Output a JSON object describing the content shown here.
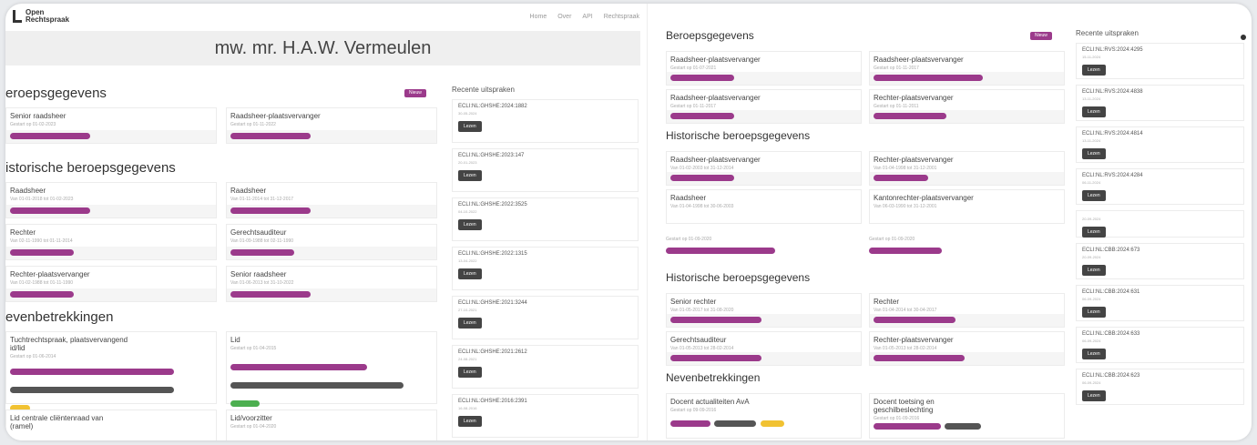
{
  "left": {
    "logo_line1": "Open",
    "logo_line2": "Rechtspraak",
    "nav": [
      "Home",
      "Over",
      "API",
      "Rechtspraak"
    ],
    "name": "mw. mr. H.A.W. Vermeulen",
    "badge_new": "Nieuw",
    "sec1": "eroepsgegevens",
    "beroep": [
      {
        "title": "Senior raadsheer",
        "sub": "Gestart op 01-02-2023"
      },
      {
        "title": "Raadsheer-plaatsvervanger",
        "sub": "Gestart op 01-11-2022"
      }
    ],
    "sec2": "istorische beroepsgegevens",
    "historisch": [
      {
        "title": "Raadsheer",
        "sub": "Van 01-01-2018 tot 01-02-2023"
      },
      {
        "title": "Raadsheer",
        "sub": "Van 01-11-2014 tot 31-12-2017"
      },
      {
        "title": "Rechter",
        "sub": "Van 02-11-1990 tot 01-11-2014"
      },
      {
        "title": "Gerechtsauditeur",
        "sub": "Van 01-09-1988 tot 02-11-1990"
      },
      {
        "title": "Rechter-plaatsvervanger",
        "sub": "Van 01-02-1988 tot 01-11-1990"
      },
      {
        "title": "Senior raadsheer",
        "sub": "Van 01-06-2013 tot 31-10-2022"
      }
    ],
    "sec3": "evenbetrekkingen",
    "neven": [
      {
        "title": "Tuchtrechtspraak, plaatsvervangend",
        "title2": "id/lid",
        "sub": "Gestart op 01-06-2014"
      },
      {
        "title": "Lid",
        "sub": "Gestart op 01-04-2015"
      },
      {
        "title": "Lid centrale cliëntenraad van",
        "title2": "(ramel)",
        "sub": ""
      },
      {
        "title": "Lid/voorzitter",
        "sub": "Gestart op 01-04-2020"
      }
    ],
    "recent_title": "Recente uitspraken",
    "recent": [
      {
        "ecli": "ECLI:NL:GHSHE:2024:1882",
        "date": "30-05-2024"
      },
      {
        "ecli": "ECLI:NL:GHSHE:2023:147",
        "date": "20-01-2023"
      },
      {
        "ecli": "ECLI:NL:GHSHE:2022:3525",
        "date": "04-10-2022"
      },
      {
        "ecli": "ECLI:NL:GHSHE:2022:1315",
        "date": "13-04-2022"
      },
      {
        "ecli": "ECLI:NL:GHSHE:2021:3244",
        "date": "27-10-2021"
      },
      {
        "ecli": "ECLI:NL:GHSHE:2021:2612",
        "date": "24-08-2021"
      },
      {
        "ecli": "ECLI:NL:GHSHE:2016:2391",
        "date": "16-08-2016"
      }
    ],
    "btn": "Lezen"
  },
  "right": {
    "badge_new": "Nieuw",
    "sec1": "Beroepsgegevens",
    "beroep": [
      {
        "title": "Raadsheer-plaatsvervanger",
        "sub": "Gestart op 01-07-2021"
      },
      {
        "title": "Raadsheer-plaatsvervanger",
        "sub": "Gestart op 01-11-2017"
      },
      {
        "title": "Raadsheer-plaatsvervanger",
        "sub": "Gestart op 01-11-2017"
      },
      {
        "title": "Rechter-plaatsvervanger",
        "sub": "Gestart op 01-11-2011"
      }
    ],
    "sec2": "Historische beroepsgegevens",
    "historisch": [
      {
        "title": "Raadsheer-plaatsvervanger",
        "sub": "Van 01-02-2003 tot 31-12-2014"
      },
      {
        "title": "Rechter-plaatsvervanger",
        "sub": "Van 01-04-1998 tot 31-12-2001"
      },
      {
        "title": "Raadsheer",
        "sub": "Van 01-04-1998 tot 30-06-2003"
      },
      {
        "title": "Kantonrechter-plaatsvervanger",
        "sub": "Van 06-03-1990 tot 31-12-2001"
      }
    ],
    "sub_dates": [
      "Gestart op 01-09-2020",
      "Gestart op 01-09-2020"
    ],
    "sec3": "Historische beroepsgegevens",
    "historisch2": [
      {
        "title": "Senior rechter",
        "sub": "Van 01-05-2017 tot 31-08-2020"
      },
      {
        "title": "Rechter",
        "sub": "Van 01-04-2014 tot 30-04-2017"
      },
      {
        "title": "Gerechtsauditeur",
        "sub": "Van 01-05-2013 tot 28-02-2014"
      },
      {
        "title": "Rechter-plaatsvervanger",
        "sub": "Van 01-05-2013 tot 28-02-2014"
      }
    ],
    "sec4": "Nevenbetrekkingen",
    "neven": [
      {
        "title": "Docent actualiteiten AvA",
        "title2": "",
        "sub": "Gestart op 09-09-2016"
      },
      {
        "title": "Docent toetsing en",
        "title2": "geschilbeslechting",
        "sub": "Gestart op 01-09-2016"
      }
    ],
    "recent_title": "Recente uitspraken",
    "recent": [
      {
        "ecli": "ECLI:NL:RVS:2024:4295",
        "date": "15-11-2024"
      },
      {
        "ecli": "ECLI:NL:RVS:2024:4838",
        "date": "13-11-2024"
      },
      {
        "ecli": "ECLI:NL:RVS:2024:4814",
        "date": "13-11-2024"
      },
      {
        "ecli": "ECLI:NL:RVS:2024:4284",
        "date": "06-11-2024"
      }
    ],
    "recent2": [
      {
        "ecli": "",
        "date": "20-09-2024"
      },
      {
        "ecli": "ECLI:NL:CBB:2024:673",
        "date": "20-09-2024"
      },
      {
        "ecli": "ECLI:NL:CBB:2024:631",
        "date": "06-09-2024"
      },
      {
        "ecli": "ECLI:NL:CBB:2024:633",
        "date": "06-09-2024"
      },
      {
        "ecli": "ECLI:NL:CBB:2024:623",
        "date": "06-09-2024"
      }
    ],
    "btn": "Lezen"
  },
  "colors": {
    "accent": "#9b3a8b",
    "button": "#444444"
  }
}
